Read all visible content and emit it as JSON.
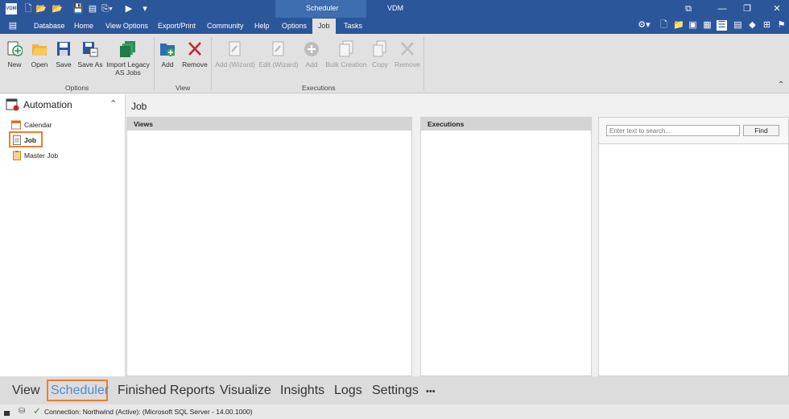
{
  "title_bar": {
    "app_badge": "VDM",
    "context_label": "Scheduler",
    "window_title": "VDM"
  },
  "ribbon_tabs": [
    "Database",
    "Home",
    "View Options",
    "Export/Print",
    "Community",
    "Help"
  ],
  "context_tabs": [
    "Options",
    "Job",
    "Tasks"
  ],
  "active_tab": "Job",
  "ribbon": {
    "options_group": {
      "label": "Options",
      "buttons": [
        "New",
        "Open",
        "Save",
        "Save As",
        "Import Legacy",
        "AS Jobs"
      ]
    },
    "view_group": {
      "label": "View",
      "buttons": [
        "Add",
        "Remove"
      ]
    },
    "executions_group": {
      "label": "Executions",
      "buttons": [
        "Add (Wizard)",
        "Edit (Wizard)",
        "Add",
        "Bulk Creation",
        "Copy",
        "Remove"
      ]
    }
  },
  "nav": {
    "header": "Automation",
    "items": [
      "Calendar",
      "Job",
      "Master Job"
    ],
    "selected": "Job"
  },
  "main": {
    "title": "Job",
    "views_header": "Views",
    "executions_header": "Executions",
    "search_placeholder": "Enter text to search...",
    "find_label": "Find"
  },
  "bottom_nav": {
    "items": [
      "View",
      "Scheduler",
      "Finished Reports",
      "Visualize",
      "Insights",
      "Logs",
      "Settings"
    ],
    "more": "•••",
    "active": "Scheduler"
  },
  "status": {
    "connection": "Connection: Northwind (Active): (Microsoft SQL Server - 14.00.1000)"
  },
  "colors": {
    "title_bar": "#2b579a",
    "accent_highlight": "#ed7d31",
    "ribbon_bg": "#e1e1e1"
  }
}
